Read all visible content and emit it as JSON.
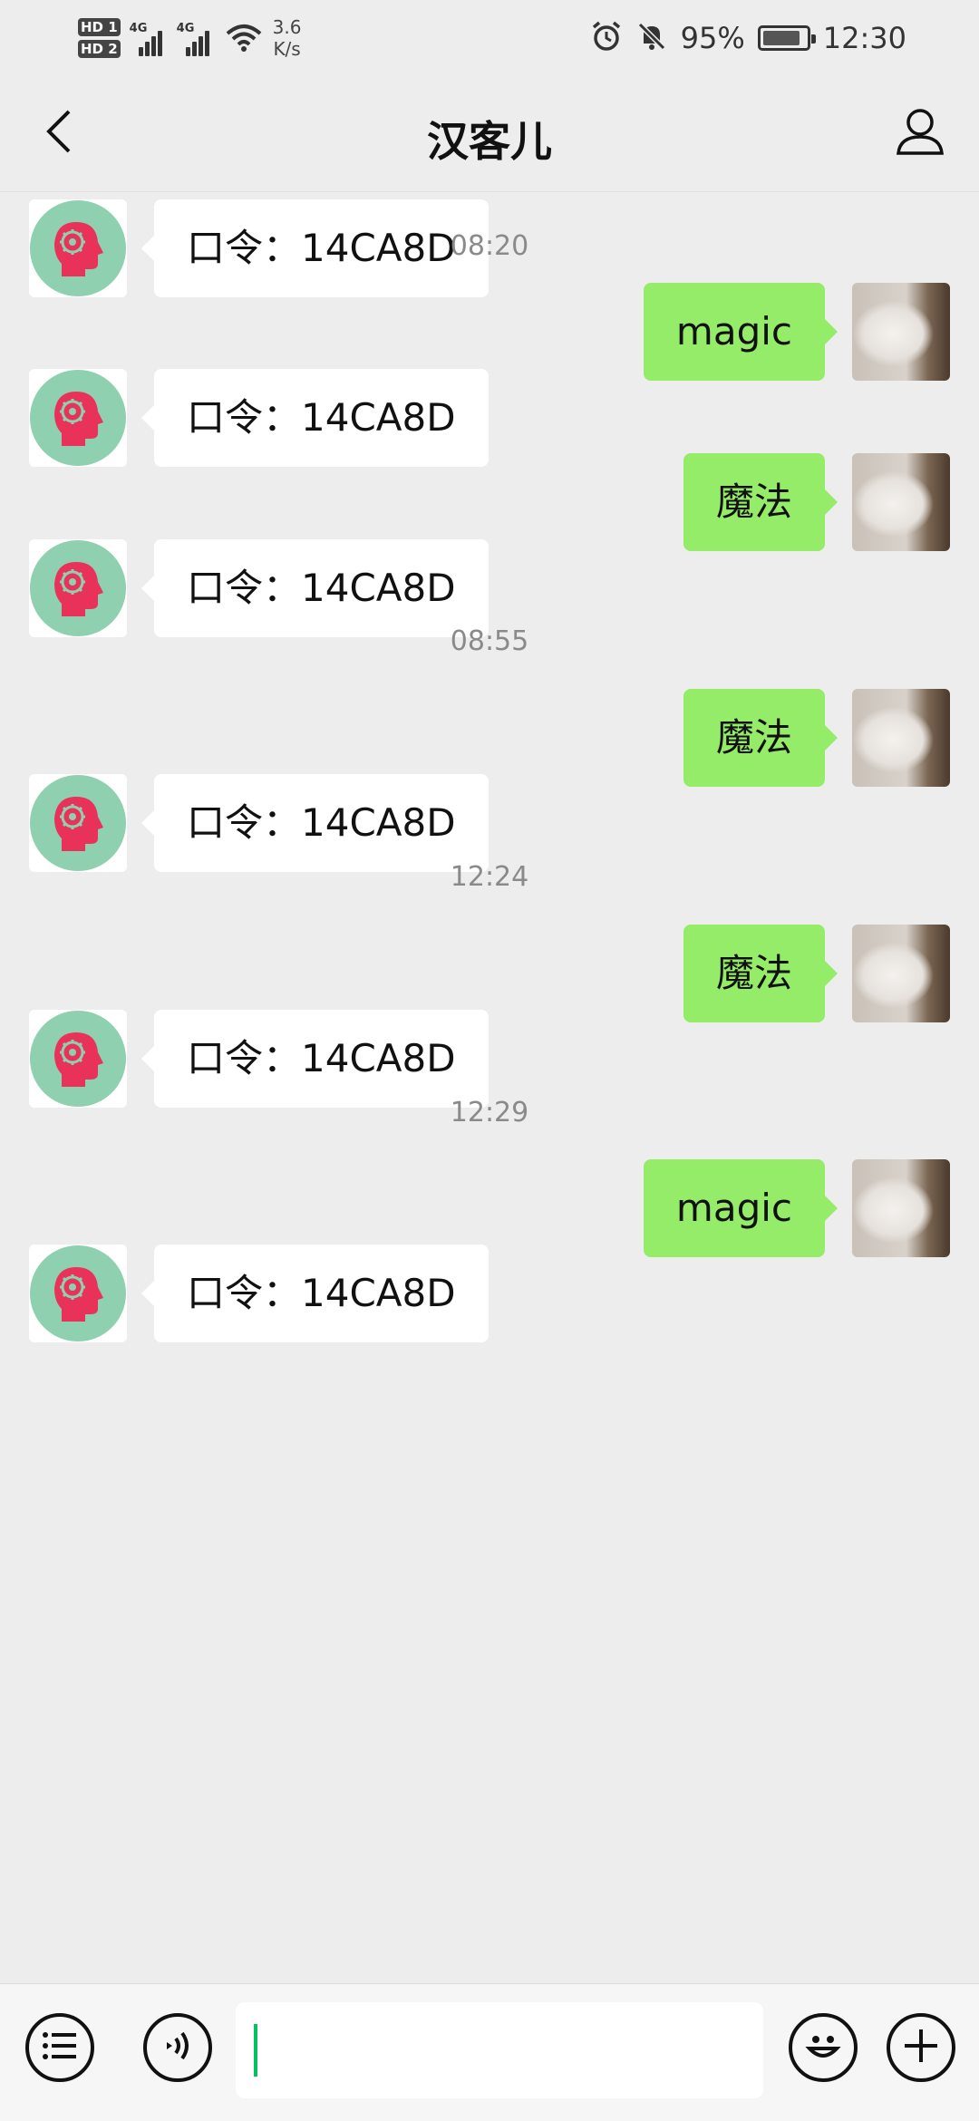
{
  "status_bar": {
    "sim1_badge": "HD 1",
    "sim2_badge": "HD 2",
    "network1": "4G",
    "network2": "4G",
    "net_speed_value": "3.6",
    "net_speed_unit": "K/s",
    "battery_percent": "95%",
    "time": "12:30",
    "icons": [
      "alarm-icon",
      "mute-icon",
      "battery-charging-icon",
      "wifi-icon",
      "signal-icon"
    ]
  },
  "nav": {
    "title": "汉客儿",
    "back_icon": "chevron-left-icon",
    "profile_icon": "person-icon"
  },
  "messages": [
    {
      "type": "in",
      "text": "口令：14CA8D"
    },
    {
      "type": "time",
      "text": "08:20"
    },
    {
      "type": "out",
      "text": "magic"
    },
    {
      "type": "in",
      "text": "口令：14CA8D"
    },
    {
      "type": "out",
      "text": "魔法"
    },
    {
      "type": "in",
      "text": "口令：14CA8D"
    },
    {
      "type": "time",
      "text": "08:55"
    },
    {
      "type": "out",
      "text": "魔法"
    },
    {
      "type": "in",
      "text": "口令：14CA8D"
    },
    {
      "type": "time",
      "text": "12:24"
    },
    {
      "type": "out",
      "text": "魔法"
    },
    {
      "type": "in",
      "text": "口令：14CA8D"
    },
    {
      "type": "time",
      "text": "12:29"
    },
    {
      "type": "out",
      "text": "magic"
    },
    {
      "type": "in",
      "text": "口令：14CA8D"
    }
  ],
  "input_bar": {
    "menu_icon": "list-menu-icon",
    "voice_icon": "voice-icon",
    "message_value": "",
    "emoji_icon": "emoji-icon",
    "add_icon": "plus-icon"
  },
  "colors": {
    "background": "#ededed",
    "outgoing_bubble": "#95ec69",
    "incoming_bubble": "#ffffff",
    "bot_avatar_bg": "#8fd0b0",
    "bot_avatar_head": "#e8325a",
    "caret": "#07c160"
  }
}
